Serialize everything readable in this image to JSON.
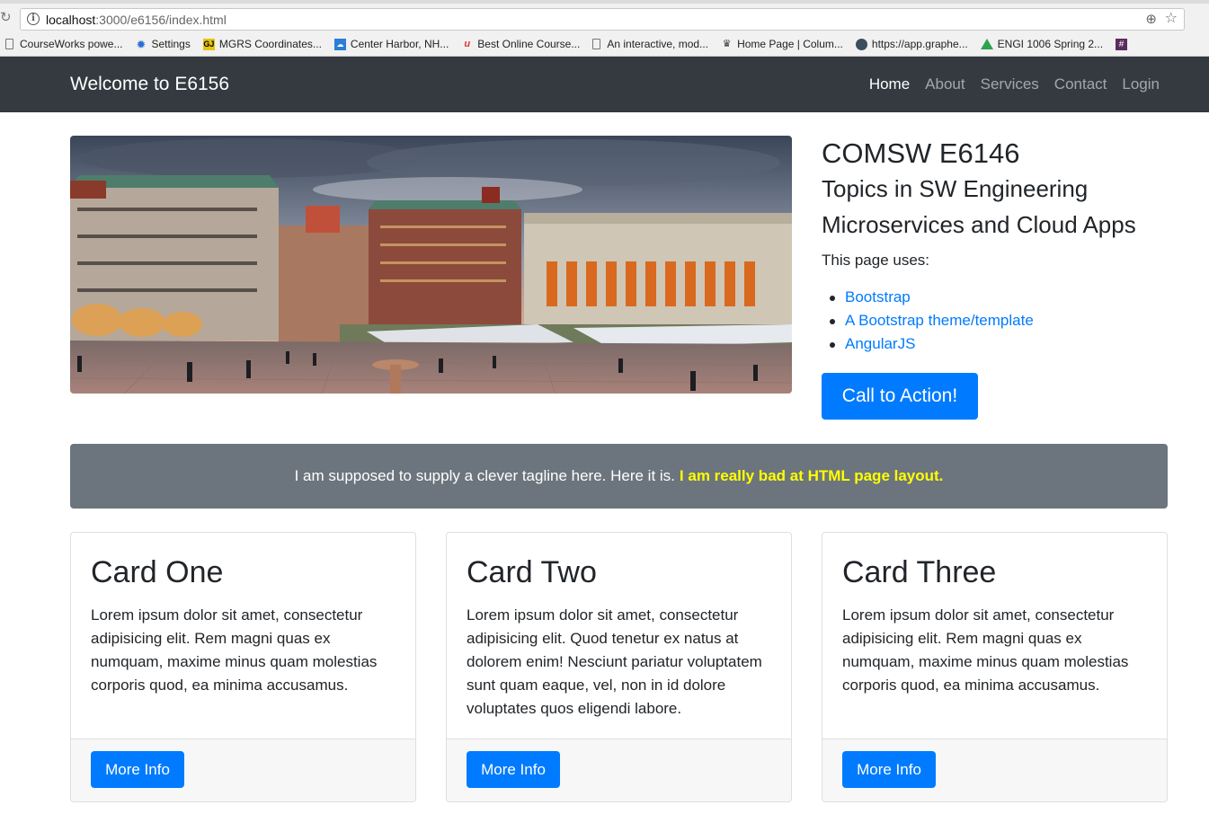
{
  "browser": {
    "url_host": "localhost",
    "url_rest": ":3000/e6156/index.html",
    "bookmarks": [
      {
        "label": "CourseWorks powe...",
        "icon": "page-icon"
      },
      {
        "label": "Settings",
        "icon": "gear-icon"
      },
      {
        "label": "MGRS Coordinates...",
        "icon": "mgrs-icon"
      },
      {
        "label": "Center Harbor, NH...",
        "icon": "weather-icon"
      },
      {
        "label": "Best Online Course...",
        "icon": "coursera-icon"
      },
      {
        "label": "An interactive, mod...",
        "icon": "page-icon"
      },
      {
        "label": "Home Page | Colum...",
        "icon": "crown-icon"
      },
      {
        "label": "https://app.graphe...",
        "icon": "hexagon-icon"
      },
      {
        "label": "ENGI 1006 Spring 2...",
        "icon": "drive-icon"
      }
    ]
  },
  "navbar": {
    "brand": "Welcome to E6156",
    "links": [
      "Home",
      "About",
      "Services",
      "Contact",
      "Login"
    ],
    "active": "Home"
  },
  "hero": {
    "title": "COMSW E6146",
    "subtitle1": "Topics in SW Engineering",
    "subtitle2": "Microservices and Cloud Apps",
    "uses_label": "This page uses:",
    "uses": [
      "Bootstrap",
      "A Bootstrap theme/template",
      "AngularJS"
    ],
    "cta": "Call to Action!"
  },
  "tagline": {
    "text": "I am supposed to supply a clever tagline here. Here it is.",
    "highlight": "I am really bad at HTML page layout."
  },
  "cards": [
    {
      "title": "Card One",
      "text": "Lorem ipsum dolor sit amet, consectetur adipisicing elit. Rem magni quas ex numquam, maxime minus quam molestias corporis quod, ea minima accusamus.",
      "button": "More Info"
    },
    {
      "title": "Card Two",
      "text": "Lorem ipsum dolor sit amet, consectetur adipisicing elit. Quod tenetur ex natus at dolorem enim! Nesciunt pariatur voluptatem sunt quam eaque, vel, non in id dolore voluptates quos eligendi labore.",
      "button": "More Info"
    },
    {
      "title": "Card Three",
      "text": "Lorem ipsum dolor sit amet, consectetur adipisicing elit. Rem magni quas ex numquam, maxime minus quam molestias corporis quod, ea minima accusamus.",
      "button": "More Info"
    }
  ],
  "colors": {
    "navbar_bg": "#343a40",
    "primary": "#007bff",
    "tagline_bg": "#6c757d",
    "tagline_highlight": "#ffff00"
  }
}
